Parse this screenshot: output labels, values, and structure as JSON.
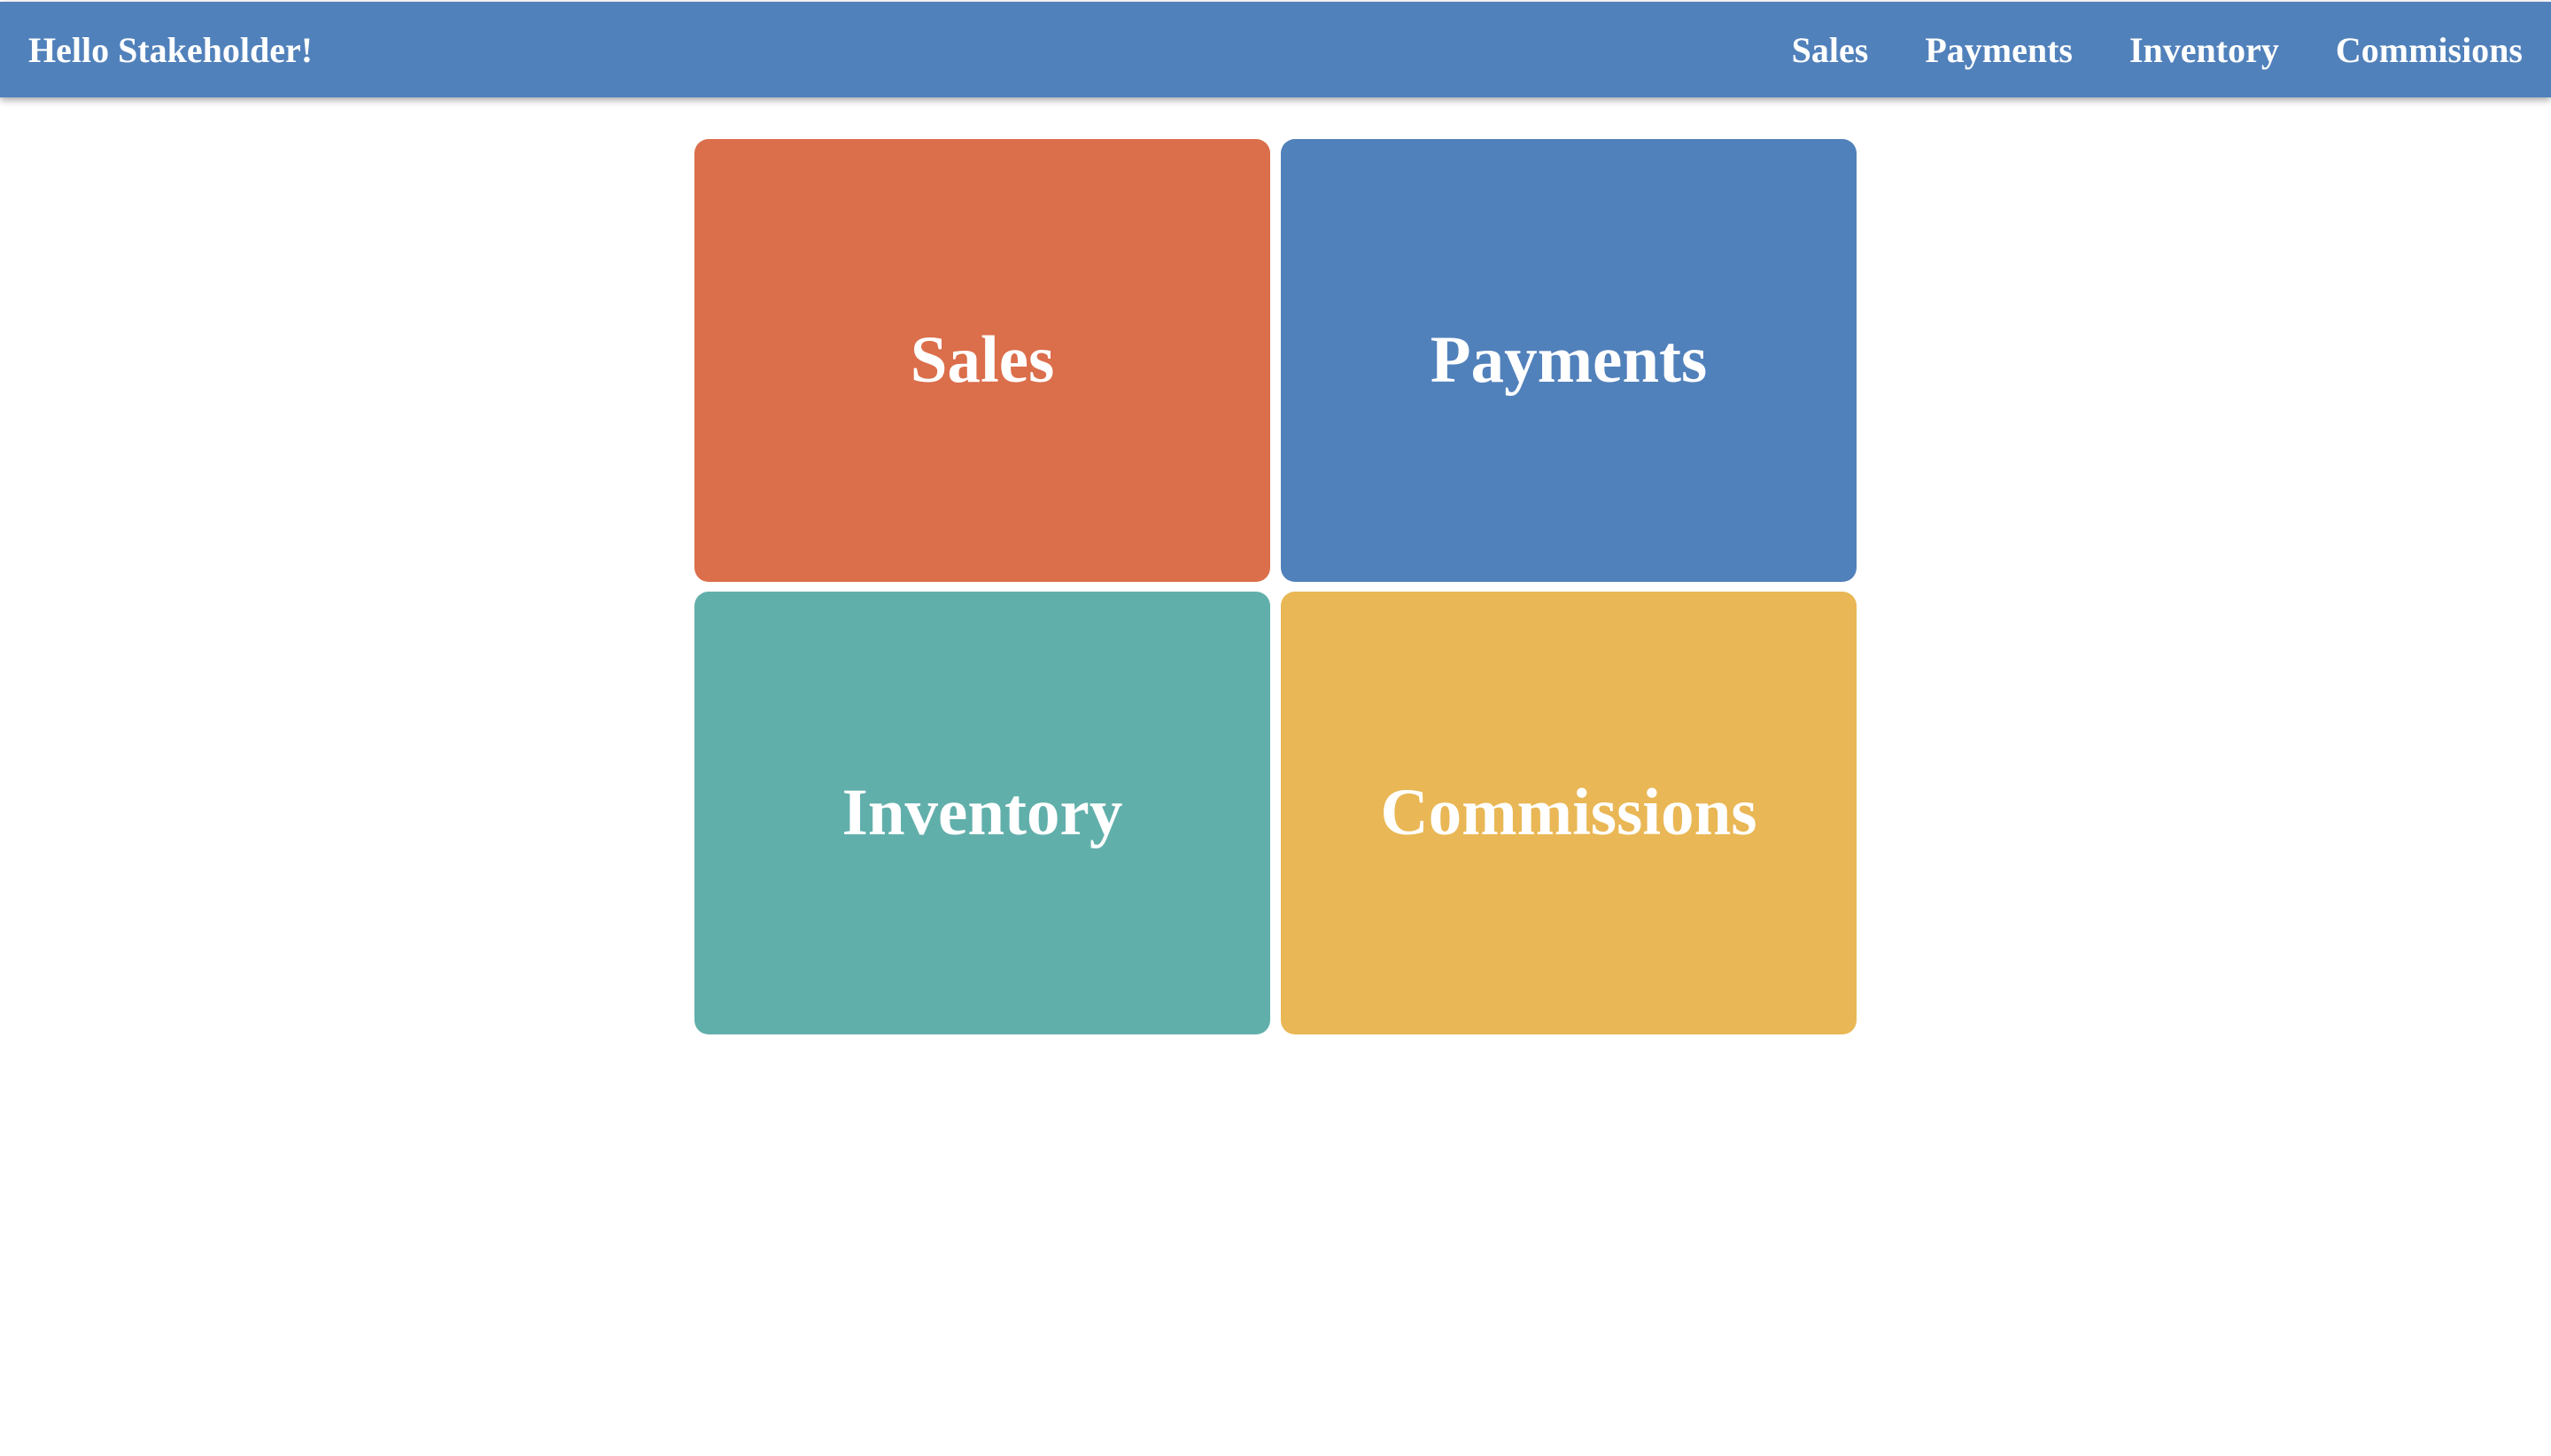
{
  "navbar": {
    "greeting": "Hello Stakeholder!",
    "links": [
      {
        "label": "Sales"
      },
      {
        "label": "Payments"
      },
      {
        "label": "Inventory"
      },
      {
        "label": "Commisions"
      }
    ],
    "background_color": "#5181bb"
  },
  "tiles": [
    {
      "label": "Sales",
      "color": "#db6e4b"
    },
    {
      "label": "Payments",
      "color": "#5181bb"
    },
    {
      "label": "Inventory",
      "color": "#61afab"
    },
    {
      "label": "Commissions",
      "color": "#e9b755"
    }
  ]
}
